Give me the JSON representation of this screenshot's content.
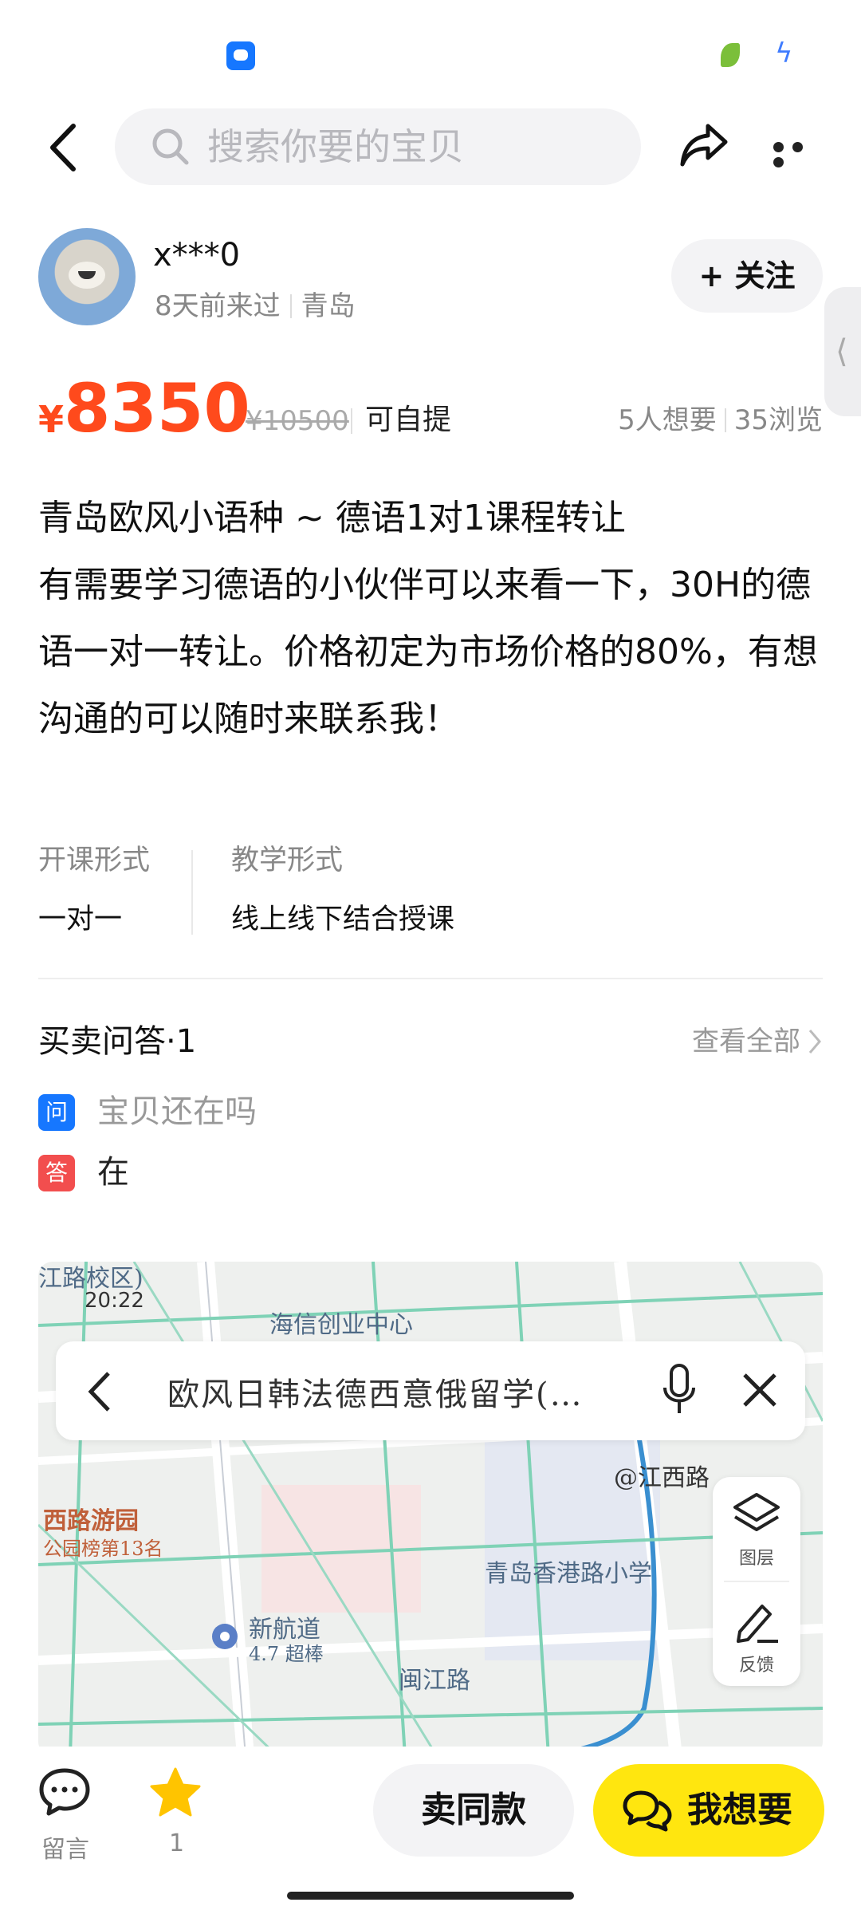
{
  "colors": {
    "price": "#ff4a1c",
    "primary_button": "#ffe60f",
    "question_badge": "#1677ff",
    "answer_badge": "#f24e4e"
  },
  "status_bar": {
    "icons": [
      "app-icon",
      "leaf-icon",
      "charging-bolt-icon"
    ]
  },
  "header": {
    "search_placeholder": "搜索你要的宝贝"
  },
  "seller": {
    "name": "x***0",
    "last_seen": "8天前来过",
    "city": "青岛",
    "follow_label": "关注"
  },
  "price": {
    "currency": "¥",
    "current": "8350",
    "original": "¥10500",
    "pickup": "可自提",
    "wants": "5人想要",
    "views": "35浏览"
  },
  "description": {
    "title": "青岛欧风小语种 ~ 德语1对1课程转让",
    "body": "有需要学习德语的小伙伴可以来看一下，30H的德语一对一转让。价格初定为市场价格的80%，有想沟通的可以随时来联系我！"
  },
  "attributes": [
    {
      "key": "开课形式",
      "value": "一对一"
    },
    {
      "key": "教学形式",
      "value": "线上线下结合授课"
    }
  ],
  "qa": {
    "title": "买卖问答·1",
    "view_all": "查看全部",
    "question_badge": "问",
    "question": "宝贝还在吗",
    "answer_badge": "答",
    "answer": "在"
  },
  "map": {
    "status_time": "20:22",
    "search_query": "欧风日韩法德西意俄留学(…",
    "labels": [
      "江路校区)",
      "海信创业中心",
      "@江西路",
      "西路游园",
      "公园榜第13名",
      "青岛香港路小学",
      "新航道",
      "4.7 超棒",
      "闽江路"
    ],
    "tool_layers": "图层",
    "tool_feedback": "反馈"
  },
  "bottom_bar": {
    "comment_label": "留言",
    "favorite_count": "1",
    "sell_same_label": "卖同款",
    "want_label": "我想要"
  }
}
